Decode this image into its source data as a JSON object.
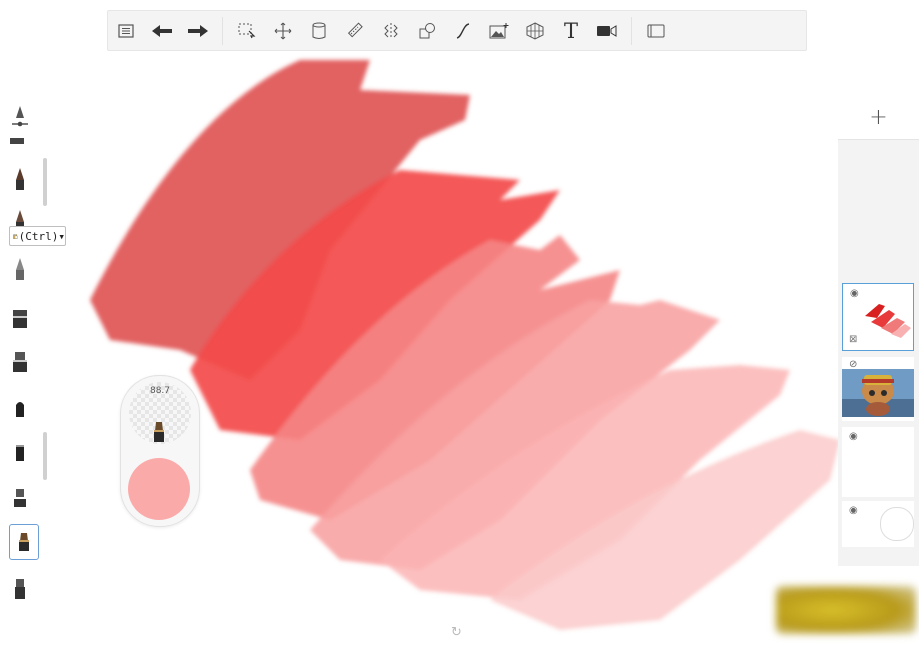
{
  "toolbar": {
    "items": [
      {
        "name": "layers-list-icon",
        "glyph": "☰"
      },
      {
        "name": "undo-icon",
        "glyph": "⟵"
      },
      {
        "name": "redo-icon",
        "glyph": "⟶"
      },
      {
        "name": "selection-icon",
        "glyph": "⬚"
      },
      {
        "name": "move-icon",
        "glyph": "✥"
      },
      {
        "name": "fill-bucket-icon",
        "glyph": "⛀"
      },
      {
        "name": "ruler-icon",
        "glyph": "⫽"
      },
      {
        "name": "symmetry-icon",
        "glyph": "⌶"
      },
      {
        "name": "shape-icon",
        "glyph": "◇"
      },
      {
        "name": "curve-icon",
        "glyph": "∫"
      },
      {
        "name": "image-import-icon",
        "glyph": "▨"
      },
      {
        "name": "perspective-grid-icon",
        "glyph": "⊞"
      },
      {
        "name": "text-icon",
        "glyph": "T"
      },
      {
        "name": "video-record-icon",
        "glyph": "■"
      },
      {
        "name": "fullscreen-icon",
        "glyph": "▭"
      }
    ]
  },
  "paste_chip": {
    "label": "(Ctrl)▾"
  },
  "brush_widget": {
    "size_value": "88.7",
    "color": "#fbaaaa"
  },
  "layers": {
    "add_label": "+",
    "items": [
      {
        "name": "layer-red-strokes",
        "visible": true,
        "active": true,
        "locked": true
      },
      {
        "name": "layer-character-image",
        "visible": false,
        "active": false
      },
      {
        "name": "layer-empty",
        "visible": true,
        "active": false
      },
      {
        "name": "layer-background",
        "visible": true,
        "active": false
      }
    ]
  },
  "colors": {
    "stroke_1": "#e05858",
    "stroke_2": "#f34a4a",
    "stroke_3": "#f58585",
    "stroke_4": "#f8a0a0",
    "stroke_5": "#fbbebe",
    "selection_accent": "#5aa0d8"
  }
}
